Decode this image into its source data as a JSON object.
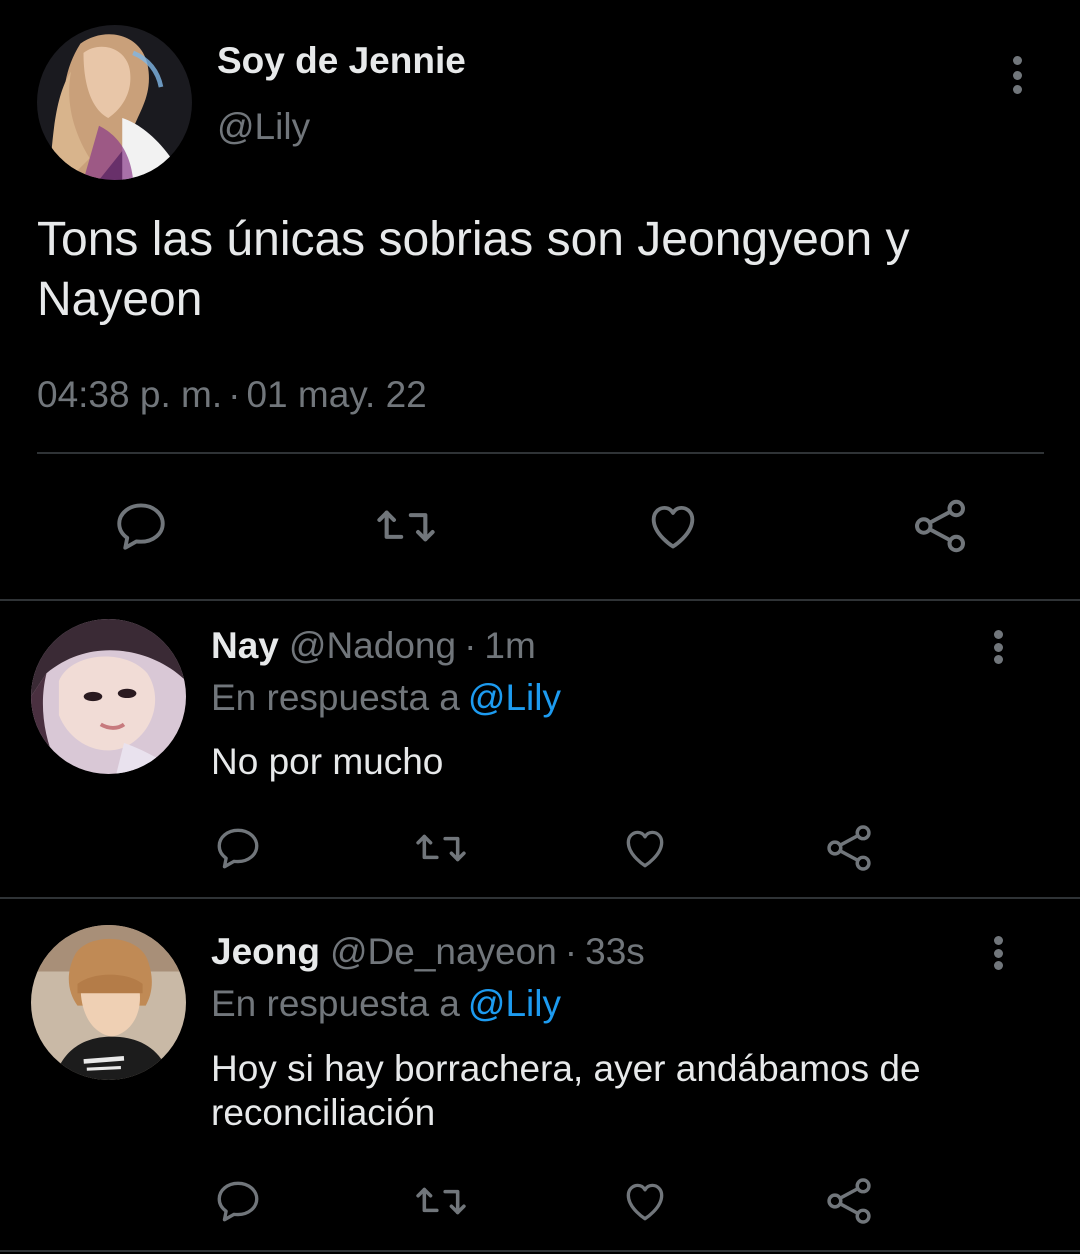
{
  "main_tweet": {
    "display_name": "Soy de Jennie",
    "handle": "@Lily",
    "text": "Tons las únicas sobrias son Jeongyeon y Nayeon",
    "time": "04:38 p. m.",
    "separator": "·",
    "date": "01 may. 22",
    "more_icon": "more-vertical-icon",
    "actions": [
      "reply-icon",
      "retweet-icon",
      "like-icon",
      "share-icon"
    ]
  },
  "replies": [
    {
      "display_name": "Nay",
      "handle": "@Nadong",
      "separator": "·",
      "time_ago": "1m",
      "reply_prefix": "En respuesta a",
      "reply_mention": "@Lily",
      "text": "No por mucho"
    },
    {
      "display_name": "Jeong",
      "handle": "@De_nayeon",
      "separator": "·",
      "time_ago": "33s",
      "reply_prefix": "En respuesta a",
      "reply_mention": "@Lily",
      "text": "Hoy si hay borrachera, ayer andábamos de reconciliación"
    }
  ],
  "colors": {
    "background": "#000000",
    "primary_text": "#e7e9ea",
    "secondary_text": "#71767b",
    "link": "#1d9bf0",
    "divider": "#2f3336"
  }
}
